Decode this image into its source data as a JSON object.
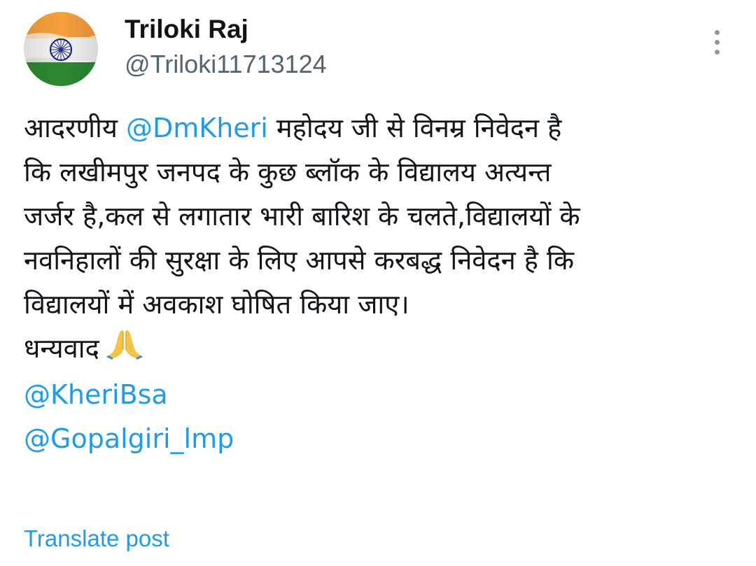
{
  "author": {
    "display_name": "Triloki Raj",
    "handle": "@Triloki11713124",
    "avatar_icon": "india-flag-avatar"
  },
  "menu": {
    "icon": "more-vertical-icon"
  },
  "post": {
    "line1_prefix": "आदरणीय ",
    "line1_mention": "@DmKheri",
    "line1_suffix": " महोदय जी से विनम्र निवेदन है",
    "line2": "कि लखीमपुर जनपद के कुछ ब्लॉक के विद्यालय अत्यन्त",
    "line3": "जर्जर है,कल से लगातार भारी बारिश के चलते,विद्यालयों के",
    "line4": "नवनिहालों की सुरक्षा के लिए आपसे करबद्ध निवेदन है कि",
    "line5": "विद्यालयों में अवकाश घोषित किया जाए।",
    "thanks": "धन्यवाद",
    "thanks_icon": "folded-hands-emoji",
    "mention_kheribsa": "@KheriBsa",
    "mention_gopalgiri": "@Gopalgiri_lmp"
  },
  "actions": {
    "translate_label": "Translate post"
  },
  "colors": {
    "link": "#1d9bf0",
    "text": "#0f1419",
    "secondary": "#536471",
    "flag_saffron": "#ff9933",
    "flag_green": "#138808",
    "chakra_blue": "#000080"
  }
}
